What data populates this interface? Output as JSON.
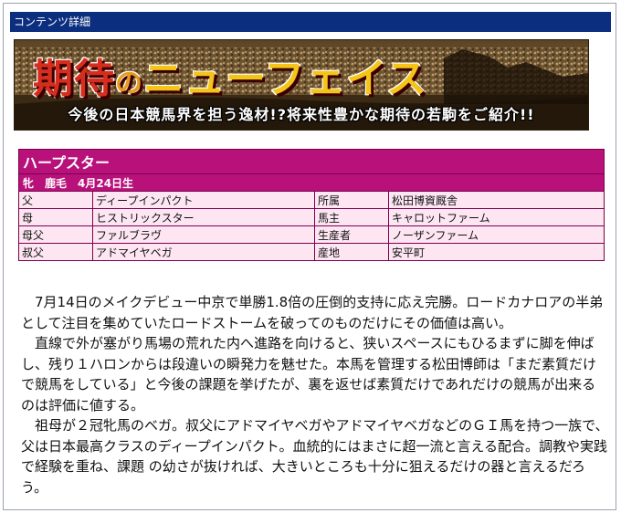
{
  "header": {
    "title": "コンテンツ詳細",
    "bg_color": "#0c2e7f"
  },
  "banner": {
    "title_part1": "期待",
    "title_part2": "の",
    "title_part3": "ニューフェイス",
    "subtitle": "今後の日本競馬界を担う逸材!?将来性豊かな期待の若駒をご紹介!!"
  },
  "horse": {
    "name": "ハープスター",
    "info": "牝　鹿毛　4月24日生",
    "accent_color": "#b8117a",
    "rows": [
      {
        "label": "父",
        "value": "ディープインパクト",
        "label2": "所属",
        "value2": "松田博資厩舎"
      },
      {
        "label": "母",
        "value": "ヒストリックスター",
        "label2": "馬主",
        "value2": "キャロットファーム"
      },
      {
        "label": "母父",
        "value": "ファルブラヴ",
        "label2": "生産者",
        "value2": "ノーザンファーム"
      },
      {
        "label": "叔父",
        "value": "アドマイヤベガ",
        "label2": "産地",
        "value2": "安平町"
      }
    ]
  },
  "article": {
    "paragraphs": [
      "7月14日のメイクデビュー中京で単勝1.8倍の圧倒的支持に応え完勝。ロードカナロアの半弟として注目を集めていたロードストームを破ってのものだけにその価値は高い。",
      "直線で外が塞がり馬場の荒れた内へ進路を向けると、狭いスペースにもひるまずに脚を伸ばし、残り１ハロンからは段違いの瞬発力を魅せた。本馬を管理する松田博師は「まだ素質だけで競馬をしている」と今後の課題を挙げたが、裏を返せば素質だけであれだけの競馬が出来るのは評価に値する。",
      "祖母が２冠牝馬のベガ。叔父にアドマイヤベガやアドマイヤベガなどのＧＩ馬を持つ一族で、父は日本最高クラスのディープインパクト。血統的にはまさに超一流と言える配合。調教や実践で経験を重ね、課題 の幼さが抜ければ、大きいところも十分に狙えるだけの器と言えるだろう。"
    ]
  }
}
